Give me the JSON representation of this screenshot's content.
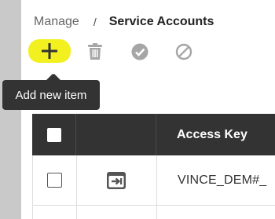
{
  "breadcrumb": {
    "parent": "Manage",
    "separator": "/",
    "current": "Service Accounts"
  },
  "toolbar": {
    "add_icon": "plus-icon",
    "delete_icon": "trash-icon",
    "approve_icon": "check-circle-icon",
    "disable_icon": "block-icon",
    "highlight_color": "#f2f01e"
  },
  "tooltip": {
    "text": "Add new item"
  },
  "table": {
    "columns": [
      "",
      "",
      "Access Key"
    ],
    "rows": [
      {
        "icon": "service-account-icon",
        "access_key": "VINCE_DEM#_"
      }
    ]
  },
  "colors": {
    "header_bg": "#333333",
    "tooltip_bg": "#333333",
    "icon_gray": "#a6a6a6"
  }
}
